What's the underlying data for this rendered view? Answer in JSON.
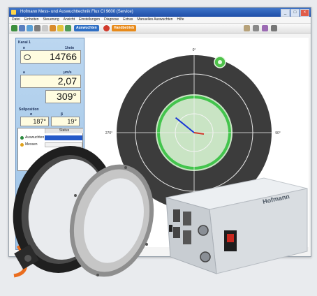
{
  "window": {
    "title": "Hofmann Mess- und Auswuchttechnik Flux CI 9600 (Service)",
    "controls": [
      "_",
      "□",
      "×"
    ]
  },
  "menu": [
    "Datei",
    "Einheiten",
    "Steuerung",
    "Ansicht",
    "Einstellungen",
    "Diagnose",
    "Extras",
    "Manuelles Auswuchten",
    "Hilfe"
  ],
  "toolbar": {
    "balance_label": "Auswuchten",
    "manual_label": "Handbetrieb"
  },
  "panel": {
    "title": "Kanal 1",
    "speed_label": "n",
    "speed_unit": "1/min",
    "speed_value": "14766",
    "amp_label": "a",
    "amp_unit": "µm/s",
    "amp_value": "2,07",
    "phase_value": "309°",
    "pos_label": "Sollposition",
    "pos_a": "α",
    "pos_b": "β",
    "pos_a_value": "187°",
    "pos_b_value": "19°"
  },
  "status_table": {
    "header": "Status",
    "rows": [
      {
        "label": "Auswuchten",
        "color": "#2b8a3e"
      },
      {
        "label": "Messen",
        "color": "#e0a21b"
      }
    ]
  },
  "polar": {
    "label_top": "0°",
    "label_right": "90°",
    "label_left": "270°",
    "vector_angle_deg": 309,
    "vector_magnitude": 2.07,
    "colors": {
      "outer": "#3c3c3c",
      "inner": "#c9e4c4",
      "ring": "#43c44d",
      "vector": "#1836d6"
    }
  },
  "hardware": {
    "brand": "Hofmann"
  }
}
